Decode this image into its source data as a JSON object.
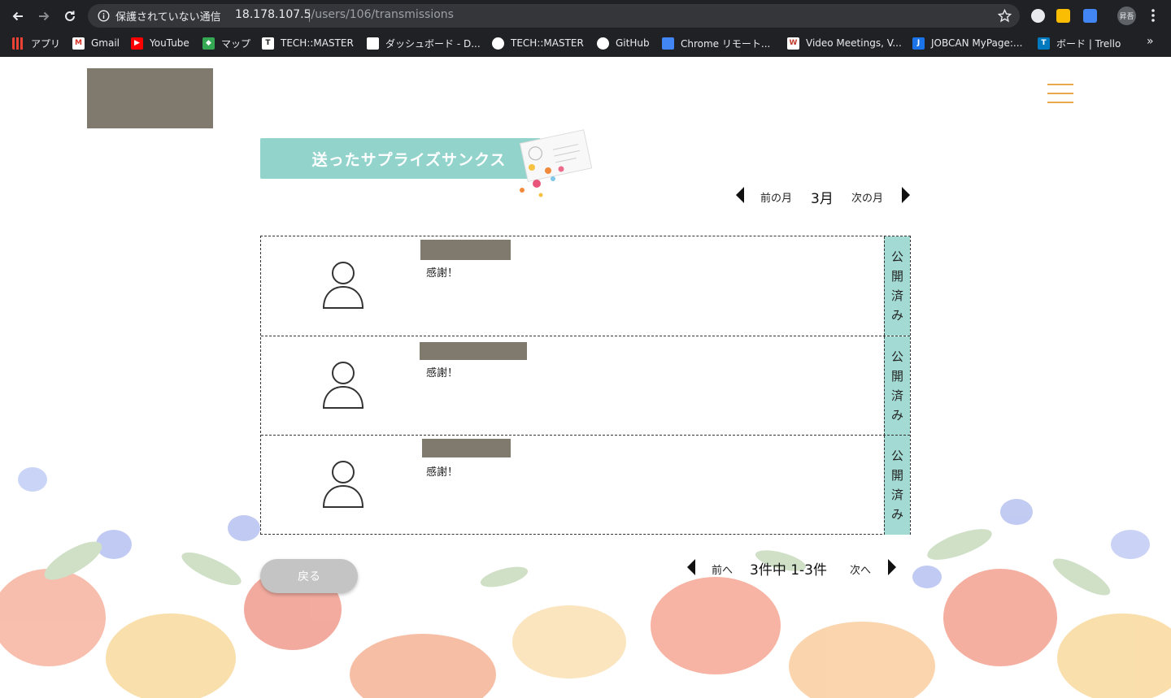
{
  "browser": {
    "security_text": "保護されていない通信",
    "url_host": "18.178.107.5",
    "url_path": "/users/106/transmissions",
    "profile_label": "昇吾",
    "bookmarks": [
      {
        "label": "アプリ",
        "icon": "apps-grid-icon",
        "color": "#e94235"
      },
      {
        "label": "Gmail",
        "icon": "gmail-icon",
        "color": "#d93025"
      },
      {
        "label": "YouTube",
        "icon": "youtube-icon",
        "color": "#ff0000"
      },
      {
        "label": "マップ",
        "icon": "maps-icon",
        "color": "#34a853"
      },
      {
        "label": "TECH::MASTER",
        "icon": "techmaster-icon",
        "color": "#ffffff"
      },
      {
        "label": "ダッシュボード - D...",
        "icon": "dashboard-icon",
        "color": "#ffffff"
      },
      {
        "label": "TECH::MASTER",
        "icon": "globe-icon",
        "color": "#ffffff"
      },
      {
        "label": "GitHub",
        "icon": "github-icon",
        "color": "#ffffff"
      },
      {
        "label": "Chrome リモート...",
        "icon": "chrome-remote-icon",
        "color": "#4285f4"
      },
      {
        "label": "Video Meetings, V...",
        "icon": "whereby-icon",
        "color": "#ffffff"
      },
      {
        "label": "JOBCAN MyPage:...",
        "icon": "jobcan-icon",
        "color": "#1a73e8"
      },
      {
        "label": "ボード | Trello",
        "icon": "trello-icon",
        "color": "#0079bf"
      }
    ],
    "more_label": "»"
  },
  "page": {
    "title": "送ったサプライズサンクス",
    "month_nav": {
      "prev_label": "前の月",
      "current": "3月",
      "next_label": "次の月"
    },
    "items": [
      {
        "message": "感謝！",
        "status": [
          "公",
          "開",
          "済",
          "み"
        ]
      },
      {
        "message": "感謝！",
        "status": [
          "公",
          "開",
          "済",
          "み"
        ]
      },
      {
        "message": "感謝！",
        "status": [
          "公",
          "開",
          "済",
          "み"
        ]
      }
    ],
    "back_label": "戻る",
    "pager": {
      "prev_label": "前へ",
      "summary": "3件中 1-3件",
      "next_label": "次へ"
    }
  },
  "colors": {
    "accent_teal": "#92d3cb",
    "status_teal": "#a3dbd4",
    "hamburger": "#e9a94b",
    "redaction": "#7f7a6d"
  }
}
